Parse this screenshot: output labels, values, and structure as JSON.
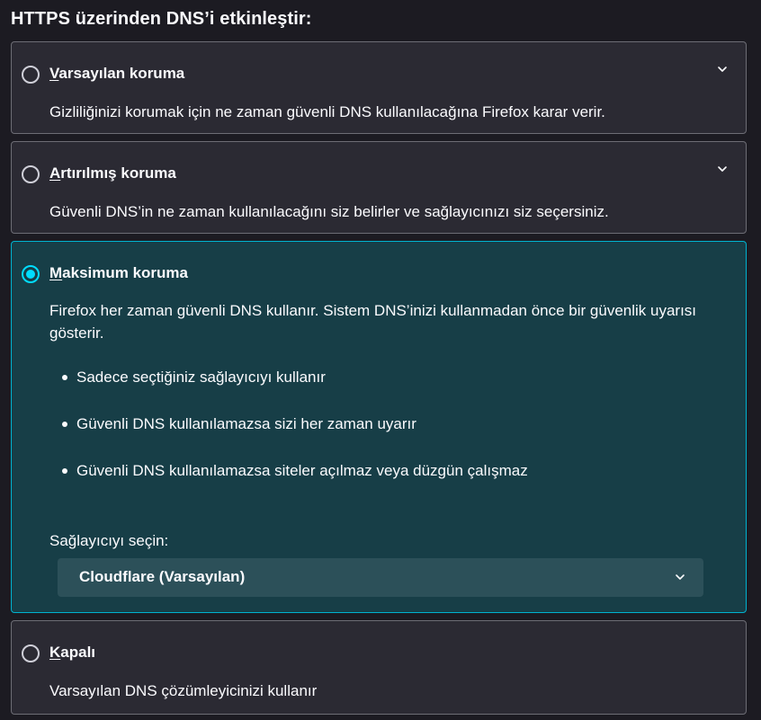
{
  "heading": "HTTPS üzerinden DNS’i etkinleştir:",
  "options": [
    {
      "accesskey": "V",
      "title_rest": "arsayılan koruma",
      "description": "Gizliliğinizi korumak için ne zaman güvenli DNS kullanılacağına Firefox karar verir.",
      "selected": false,
      "expandable": true
    },
    {
      "accesskey": "A",
      "title_rest": "rtırılmış koruma",
      "description": "Güvenli DNS’in ne zaman kullanılacağını siz belirler ve sağlayıcınızı siz seçersiniz.",
      "selected": false,
      "expandable": true
    },
    {
      "accesskey": "M",
      "title_rest": "aksimum koruma",
      "description": "Firefox her zaman güvenli DNS kullanır. Sistem DNS’inizi kullanmadan önce bir güvenlik uyarısı gösterir.",
      "selected": true,
      "expandable": false,
      "bullets": [
        "Sadece seçtiğiniz sağlayıcıyı kullanır",
        "Güvenli DNS kullanılamazsa sizi her zaman uyarır",
        "Güvenli DNS kullanılamazsa siteler açılmaz veya düzgün çalışmaz"
      ],
      "provider_label": "Sağlayıcıyı seçin:",
      "provider_value": "Cloudflare (Varsayılan)"
    },
    {
      "accesskey": "K",
      "title_rest": "apalı",
      "description": "Varsayılan DNS çözümleyicinizi kullanır",
      "selected": false,
      "expandable": false
    }
  ],
  "colors": {
    "background": "#1c1b22",
    "card": "#2b2a33",
    "card_border": "#6d6d75",
    "selected_card": "#173e47",
    "accent": "#00ddff"
  },
  "icons": {
    "expand": "chevron-down-icon",
    "select": "chevron-down-icon"
  }
}
